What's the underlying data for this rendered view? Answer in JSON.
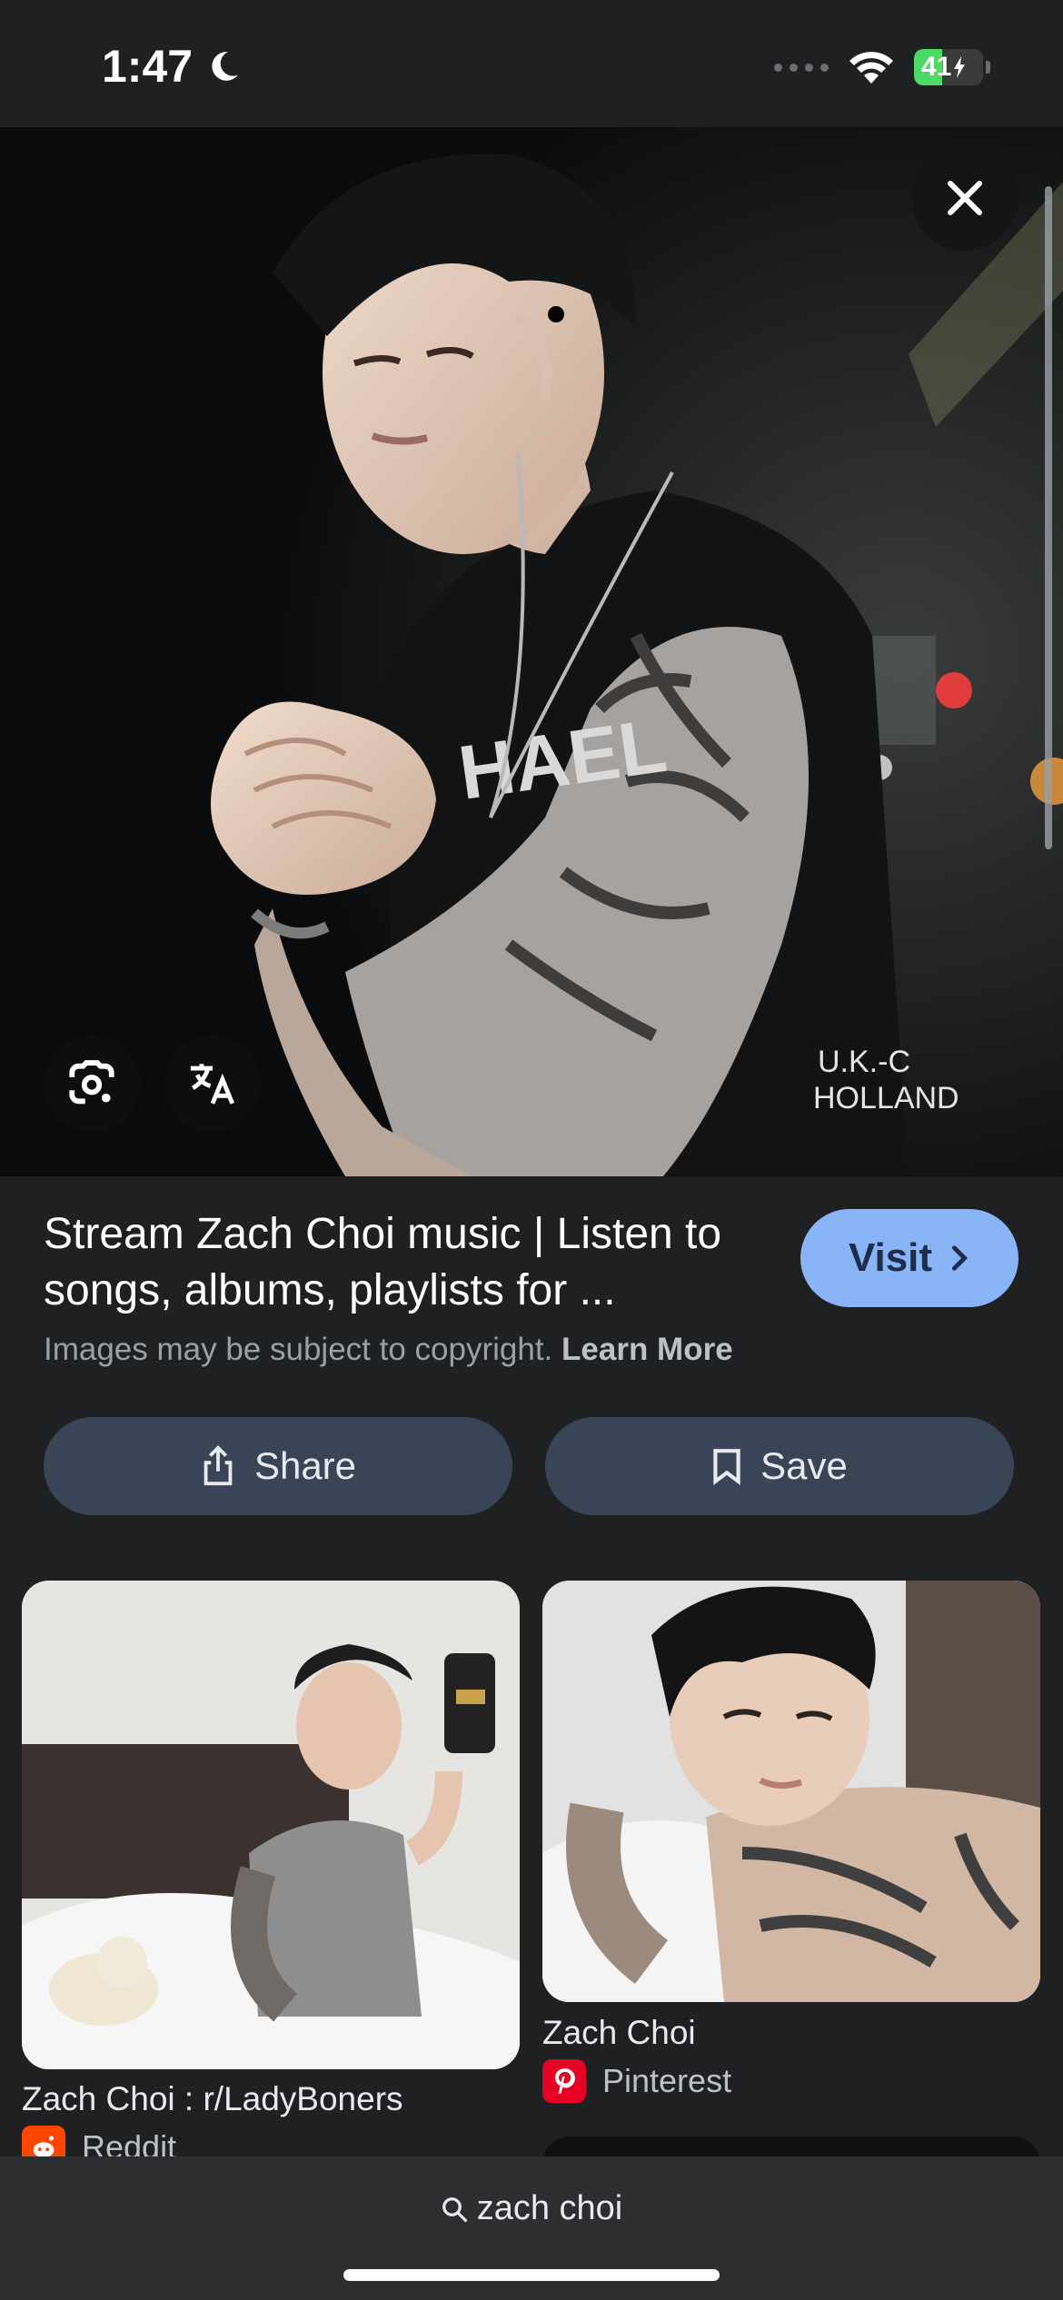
{
  "status_bar": {
    "time": "1:47",
    "battery": "41",
    "battery_level": 0.41,
    "icons": [
      "moon-icon",
      "cellular-dots-icon",
      "wifi-icon",
      "battery-charging-icon"
    ]
  },
  "viewer": {
    "close_icon": "close-icon",
    "lens_icon": "google-lens-icon",
    "translate_icon": "translate-icon"
  },
  "result": {
    "title": "Stream Zach Choi music | Listen to songs, albums, playlists for ...",
    "visit_label": "Visit",
    "copyright_text": "Images may be subject to copyright.",
    "learn_more": "Learn More"
  },
  "actions": {
    "share_label": "Share",
    "save_label": "Save"
  },
  "related": [
    {
      "title": "Zach Choi : r/LadyBoners",
      "source": "Reddit"
    },
    {
      "title": "Zach Choi",
      "source": "Pinterest"
    }
  ],
  "search": {
    "query": "zach choi"
  },
  "colors": {
    "accent": "#8ab4f8",
    "button_bg": "#394457",
    "background": "#1f2021",
    "battery": "#4cd964",
    "pinterest": "#e60023",
    "reddit": "#ff4500"
  }
}
